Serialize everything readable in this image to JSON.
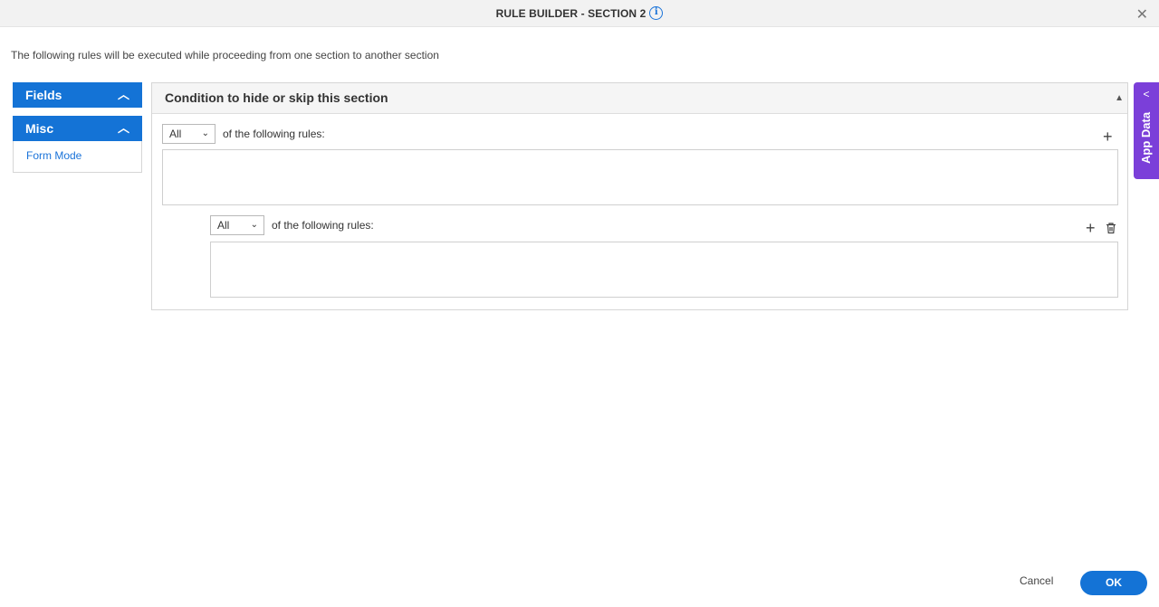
{
  "window": {
    "title": "RULE BUILDER - SECTION 2",
    "info_icon": "info-icon",
    "close_icon": "close-icon"
  },
  "subtitle": "The following rules will be executed while proceeding from one section to another section",
  "left_panel": {
    "fields": {
      "label": "Fields",
      "icon": "chevron-up-icon"
    },
    "misc": {
      "label": "Misc",
      "icon": "chevron-up-icon",
      "items": [
        "Form Mode"
      ]
    }
  },
  "condition_panel": {
    "title": "Condition to hide or skip this section",
    "collapse_icon": "triangle-up-icon",
    "rule_group": {
      "match_value": "All",
      "label": "of the following rules:",
      "add_icon": "plus-icon",
      "nested_group": {
        "match_value": "All",
        "label": "of the following rules:",
        "add_icon": "plus-icon",
        "delete_icon": "trash-icon"
      }
    }
  },
  "app_data_tab": {
    "label": "App Data",
    "icon": "chevron-left-icon"
  },
  "footer": {
    "cancel_label": "Cancel",
    "ok_label": "OK"
  },
  "colors": {
    "primary": "#1473d6",
    "app_data": "#7b3fd9",
    "link": "#1a73d9"
  }
}
